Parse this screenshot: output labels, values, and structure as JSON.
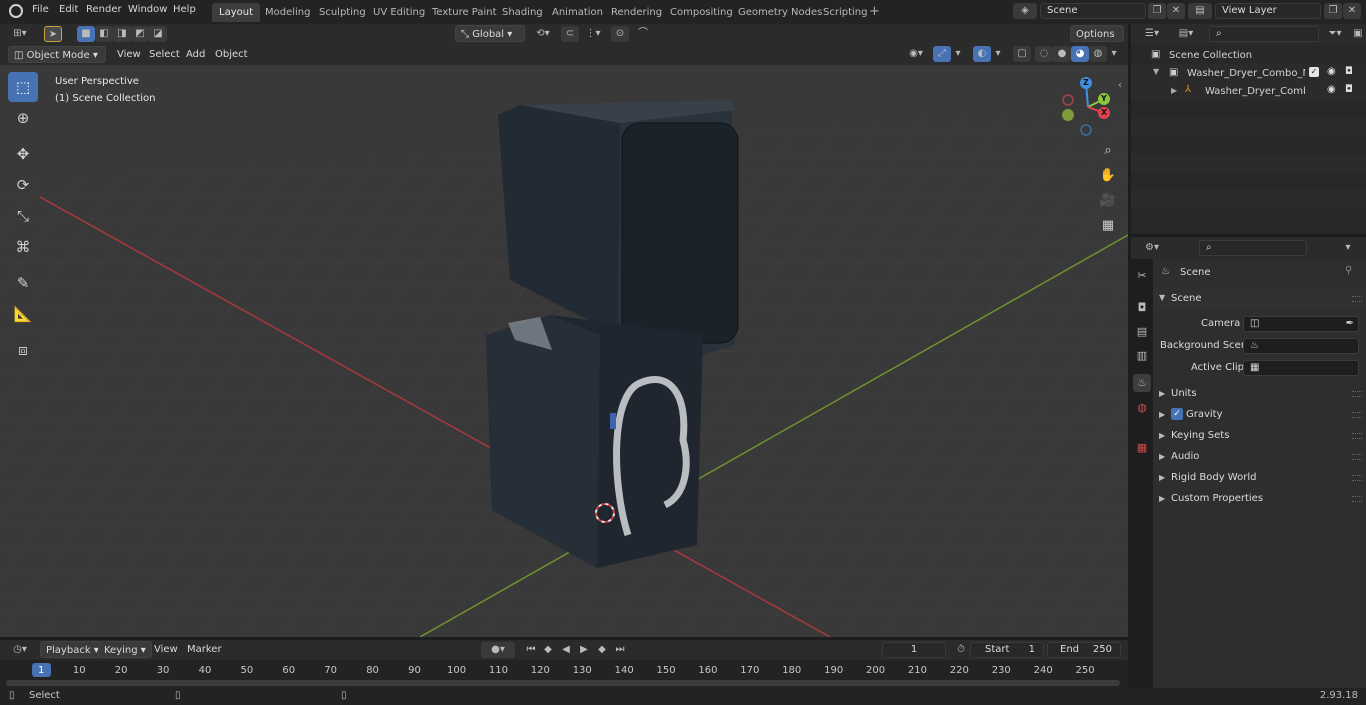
{
  "menu": {
    "file": "File",
    "edit": "Edit",
    "render": "Render",
    "window": "Window",
    "help": "Help"
  },
  "workspaces": [
    "Layout",
    "Modeling",
    "Sculpting",
    "UV Editing",
    "Texture Paint",
    "Shading",
    "Animation",
    "Rendering",
    "Compositing",
    "Geometry Nodes",
    "Scripting"
  ],
  "scene_name": "Scene",
  "view_layer": "View Layer",
  "header3d": {
    "mode": "Object Mode",
    "view": "View",
    "select": "Select",
    "add": "Add",
    "object": "Object",
    "transform_orientation": "Global",
    "options": "Options"
  },
  "viewport": {
    "perspective": "User Perspective",
    "collection": "(1) Scene Collection",
    "gizmo": {
      "z": "Z",
      "y": "Y",
      "x": "X"
    }
  },
  "outliner": {
    "root": "Scene Collection",
    "item1": "Washer_Dryer_Combo_Machi",
    "item2": "Washer_Dryer_Combo_M"
  },
  "properties": {
    "breadcrumb": "Scene",
    "panel": "Scene",
    "camera_label": "Camera",
    "bg_scene_label": "Background Scene",
    "active_clip_label": "Active Clip",
    "sections": [
      "Units",
      "Gravity",
      "Keying Sets",
      "Audio",
      "Rigid Body World",
      "Custom Properties"
    ],
    "gravity_checked": true
  },
  "timeline": {
    "playback": "Playback",
    "keying": "Keying",
    "view": "View",
    "marker": "Marker",
    "current_frame": "1",
    "start_label": "Start",
    "start": "1",
    "end_label": "End",
    "end": "250",
    "ticks": [
      "1",
      "10",
      "20",
      "30",
      "40",
      "50",
      "60",
      "70",
      "80",
      "90",
      "100",
      "110",
      "120",
      "130",
      "140",
      "150",
      "160",
      "170",
      "180",
      "190",
      "200",
      "210",
      "220",
      "230",
      "240",
      "250"
    ]
  },
  "status": {
    "select": "Select",
    "version": "2.93.18"
  },
  "colors": {
    "accent": "#4772b3",
    "x_axis": "#e0434f",
    "y_axis": "#8cc63e",
    "z_axis": "#3f8fe2",
    "grid": "#434343"
  }
}
